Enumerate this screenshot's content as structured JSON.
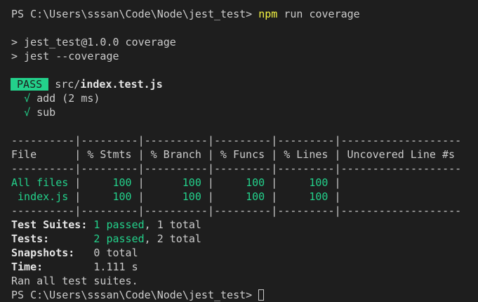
{
  "prompt1": {
    "path": "PS C:\\Users\\sssan\\Code\\Node\\jest_test> ",
    "command": "npm",
    "args": " run coverage"
  },
  "script_lines": [
    "> jest_test@1.0.0 coverage",
    "> jest --coverage"
  ],
  "result": {
    "badge": " PASS ",
    "dir": " src/",
    "file": "index.test.js"
  },
  "tests": [
    {
      "check": "√",
      "name": "add (2 ms)"
    },
    {
      "check": "√",
      "name": "sub"
    }
  ],
  "table": {
    "divider": [
      "----------",
      "---------",
      "----------",
      "---------",
      "---------",
      "-------------------"
    ],
    "headers": [
      "File",
      "% Stmts",
      "% Branch",
      "% Funcs",
      "% Lines",
      "Uncovered Line #s"
    ],
    "rows": [
      {
        "file": "All files",
        "stmts": "100",
        "branch": "100",
        "funcs": "100",
        "lines": "100",
        "uncovered": ""
      },
      {
        "file": "index.js",
        "stmts": "100",
        "branch": "100",
        "funcs": "100",
        "lines": "100",
        "uncovered": ""
      }
    ]
  },
  "summary": {
    "suites_label": "Test Suites:",
    "suites_passed": "1 passed",
    "suites_total": ", 1 total",
    "tests_label": "Tests:",
    "tests_passed": "2 passed",
    "tests_total": ", 2 total",
    "snapshots_label": "Snapshots:",
    "snapshots_value": "0 total",
    "time_label": "Time:",
    "time_value": "1.111 s",
    "ran": "Ran all test suites."
  },
  "prompt2": {
    "path": "PS C:\\Users\\sssan\\Code\\Node\\jest_test> "
  },
  "colors": {
    "background": "#1e1e1e",
    "text": "#cccccc",
    "green": "#23d18b",
    "yellow": "#f5f543"
  }
}
